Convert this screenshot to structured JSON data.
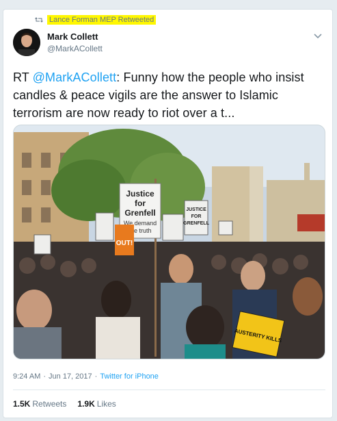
{
  "retweet_context": {
    "text": "Lance Forman MEP Retweeted",
    "highlight_color": "#fff700"
  },
  "author": {
    "display_name": "Mark Collett",
    "handle": "@MarkACollett"
  },
  "tweet": {
    "prefix": "RT ",
    "mention": "@MarkACollett",
    "body": ": Funny how the people who insist candles & peace vigils are the answer to Islamic terrorism are now ready to riot over a t..."
  },
  "media": {
    "signs": {
      "main_line1": "Justice",
      "main_line2": "for",
      "main_line3": "Grenfell",
      "main_sub1": "We demand",
      "main_sub2": "the truth",
      "right_line1": "JUSTICE",
      "right_line2": "FOR",
      "right_line3": "GRENFELL",
      "orange": "OUT!",
      "yellow": "AUSTERITY KILLS"
    }
  },
  "meta": {
    "time": "9:24 AM",
    "date": "Jun 17, 2017",
    "separator": "·",
    "source": "Twitter for iPhone"
  },
  "stats": {
    "retweets_count": "1.5K",
    "retweets_label": "Retweets",
    "likes_count": "1.9K",
    "likes_label": "Likes"
  },
  "colors": {
    "link": "#1da1f2",
    "muted": "#657786",
    "text": "#14171a"
  }
}
